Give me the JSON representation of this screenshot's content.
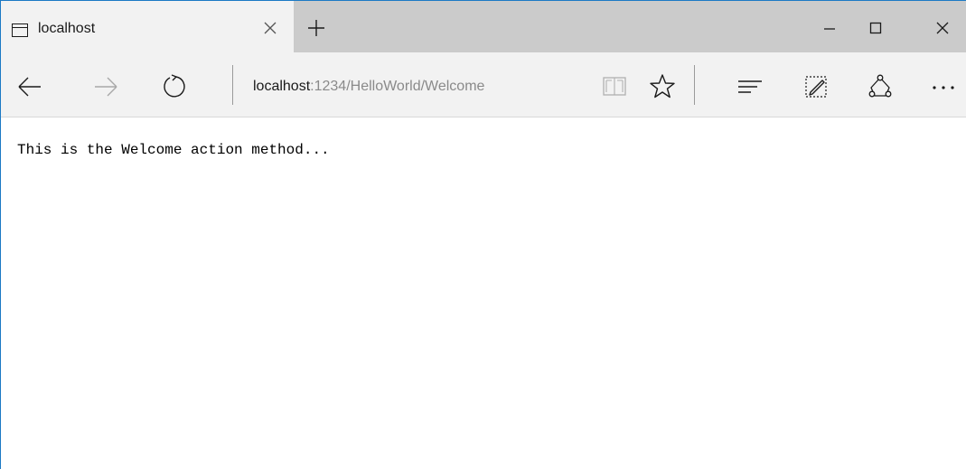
{
  "tab": {
    "title": "localhost",
    "page_icon": "page-icon",
    "close_icon": "close-icon"
  },
  "new_tab_icon": "plus-icon",
  "window_controls": [
    "minimize-icon",
    "maximize-icon",
    "close-icon"
  ],
  "toolbar": {
    "back_icon": "back-arrow-icon",
    "forward_icon": "forward-arrow-icon",
    "refresh_icon": "refresh-icon",
    "address": {
      "host": "localhost",
      "path": ":1234/HelloWorld/Welcome"
    },
    "reading_view_icon": "book-icon",
    "favorite_icon": "star-icon",
    "hub_icon": "hub-icon",
    "web_note_icon": "pen-note-icon",
    "share_icon": "share-icon",
    "more_icon": "more-icon"
  },
  "page": {
    "text": "This is the Welcome action method..."
  }
}
